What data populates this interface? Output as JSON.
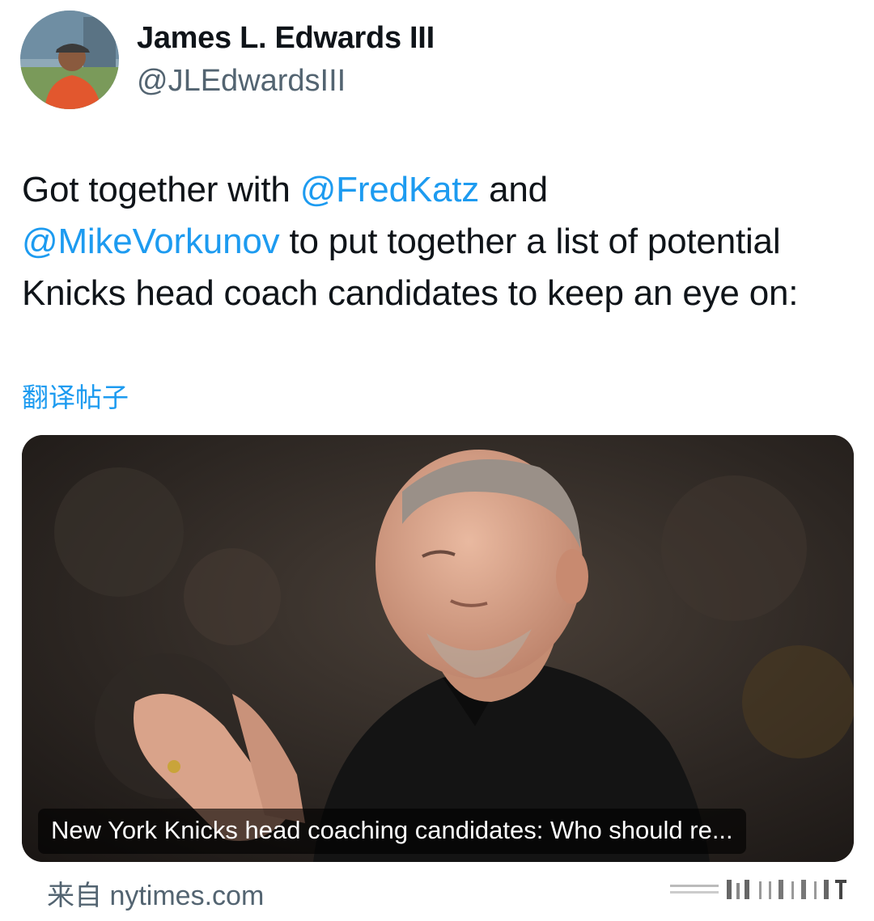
{
  "author": {
    "display_name": "James L. Edwards III",
    "handle": "@JLEdwardsIII"
  },
  "tweet": {
    "text_1": "Got together with ",
    "mention_1": "@FredKatz",
    "text_2": " and ",
    "mention_2": "@MikeVorkunov",
    "text_3": " to put together a list of potential Knicks head coach candidates to keep an eye on:",
    "translate_label": "翻译帖子"
  },
  "card": {
    "title": "New York Knicks head coaching candidates: Who should re...",
    "source": "来自 nytimes.com"
  },
  "colors": {
    "link": "#1d9bf0",
    "secondary_text": "#536471",
    "primary_text": "#0f1419"
  }
}
